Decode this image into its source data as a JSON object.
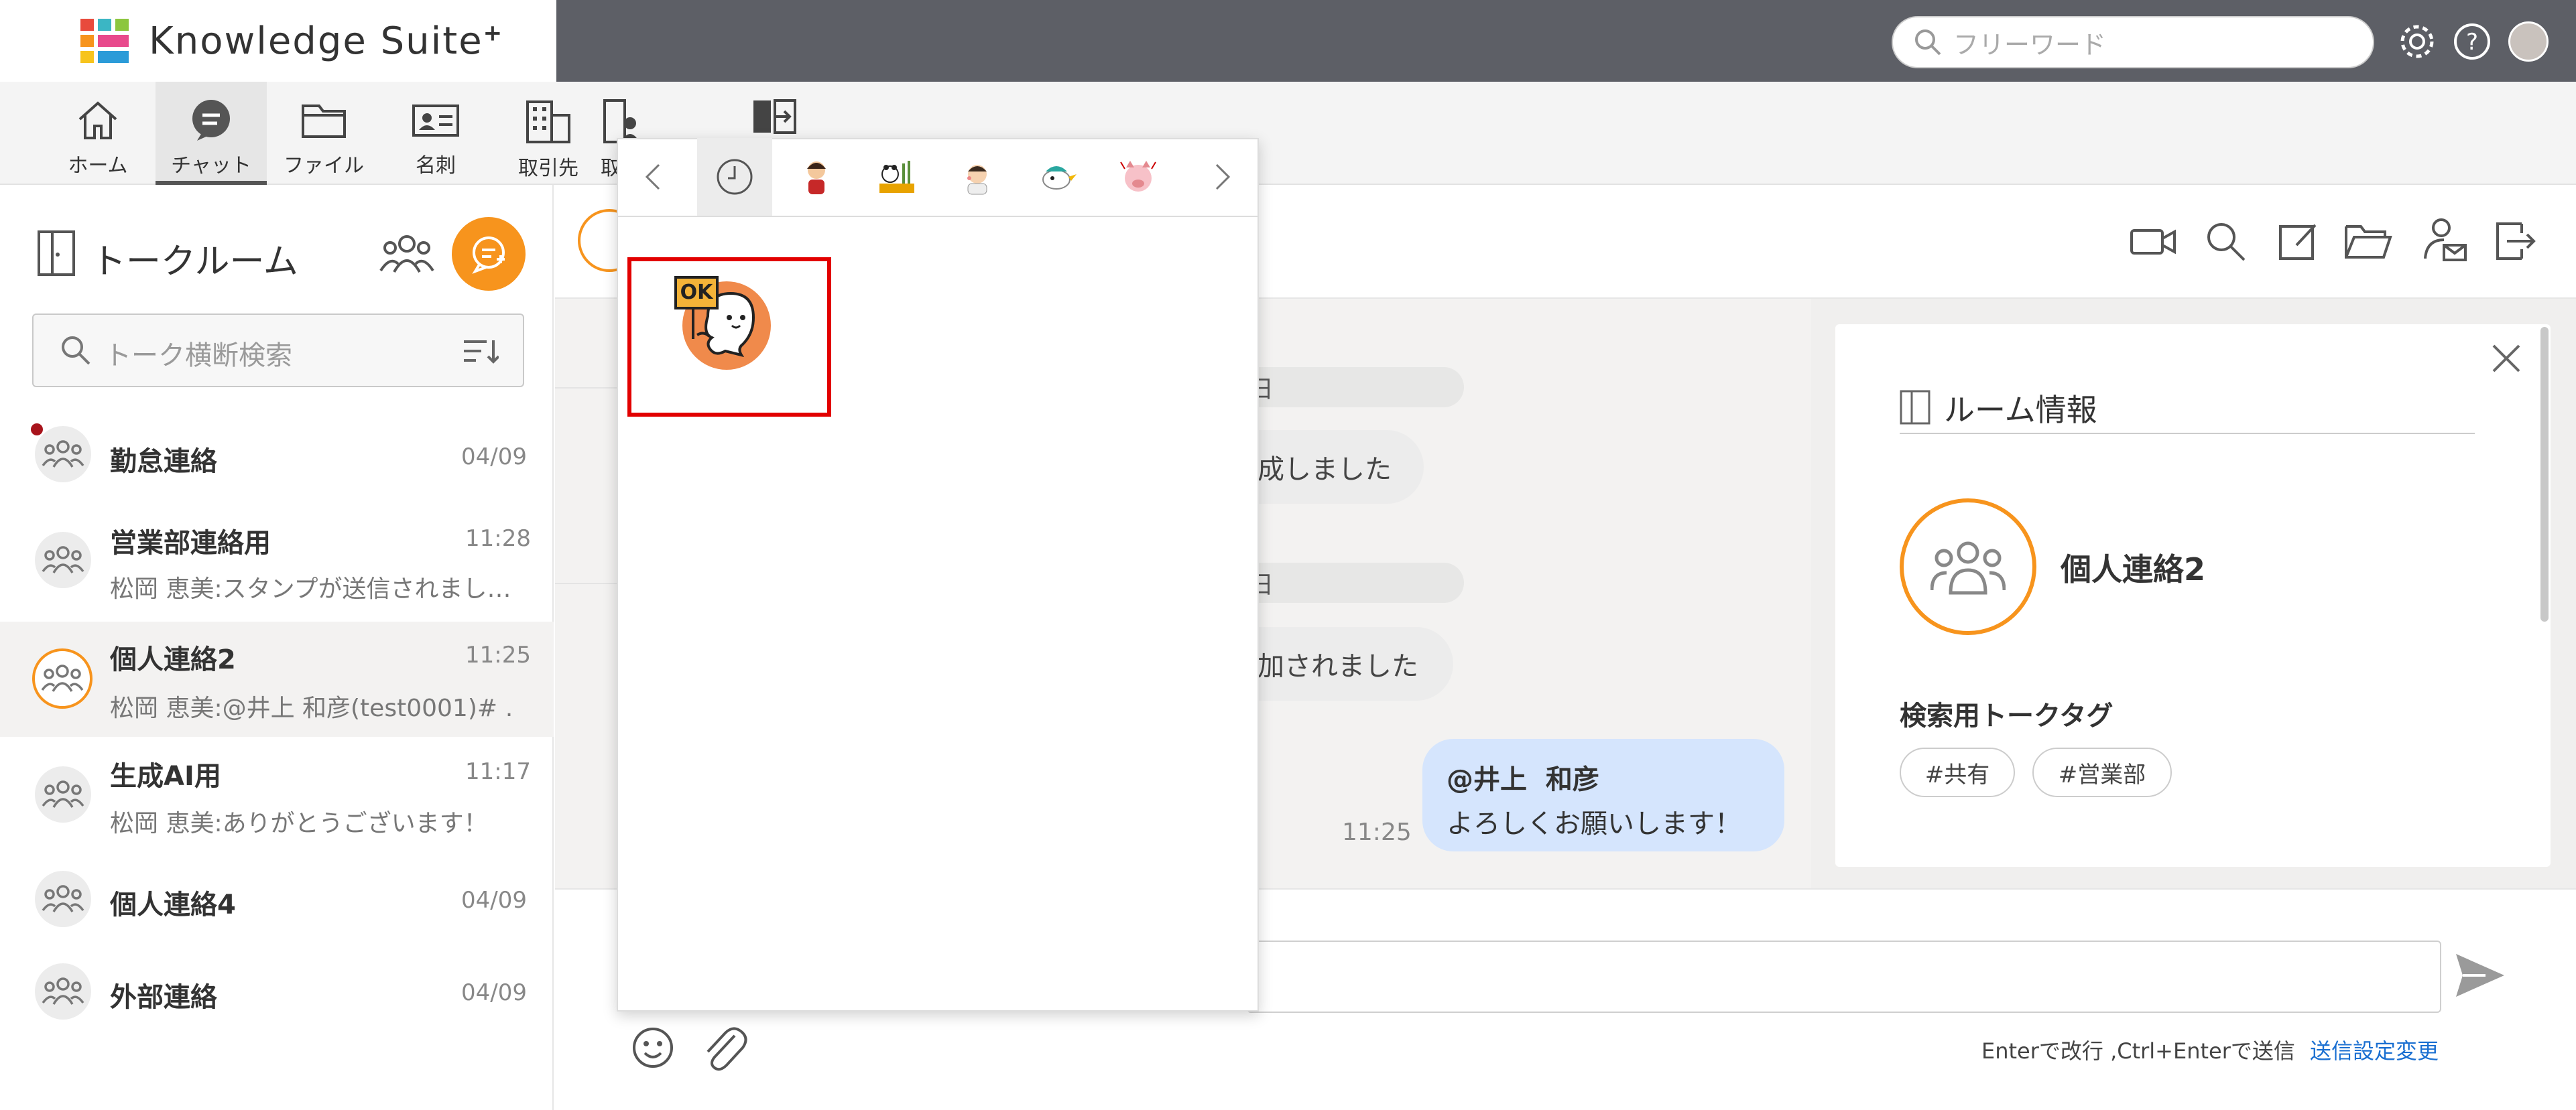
{
  "app": {
    "brand": "Knowledge Suite",
    "brand_sup": "+"
  },
  "header": {
    "search_placeholder": "フリーワード"
  },
  "nav": {
    "items": [
      {
        "label": "ホーム"
      },
      {
        "label": "チャット"
      },
      {
        "label": "ファイル"
      },
      {
        "label": "名刺"
      },
      {
        "label": "取引先"
      },
      {
        "label": "取"
      }
    ]
  },
  "sidebar": {
    "title": "トークルーム",
    "search_placeholder": "トーク横断検索",
    "rooms": [
      {
        "name": "勤怠連絡",
        "time": "04/09",
        "preview": "",
        "unread": true
      },
      {
        "name": "営業部連絡用",
        "time": "11:28",
        "preview": "松岡 恵美:スタンプが送信されまし…"
      },
      {
        "name": "個人連絡2",
        "time": "11:25",
        "preview": "松岡 恵美:@井上 和彦(test0001)# …",
        "active": true
      },
      {
        "name": "生成AI用",
        "time": "11:17",
        "preview": "松岡 恵美:ありがとうございます！"
      },
      {
        "name": "個人連絡4",
        "time": "04/09",
        "preview": ""
      },
      {
        "name": "外部連絡",
        "time": "04/09",
        "preview": ""
      }
    ]
  },
  "chat": {
    "date1": "日",
    "sys1": "成しました",
    "date2": "日",
    "sys2": "加されました",
    "my_message": {
      "mention": "@井上  和彦",
      "text": "よろしくお願いします！",
      "time": "11:25"
    },
    "input_hint": "Enterで改行 ,Ctrl+Enterで送信",
    "send_settings_link": "送信設定変更"
  },
  "room_info": {
    "title": "ルーム情報",
    "room_name": "個人連絡2",
    "tag_heading": "検索用トークタグ",
    "tags": [
      "#共有",
      "#営業部"
    ]
  },
  "stamp_picker": {
    "stamp_text": "OK"
  },
  "colors": {
    "header_bg": "#5d5f66",
    "accent_orange": "#f7941d",
    "selection_red": "#e20000",
    "my_bubble": "#d5e5fd",
    "link_blue": "#1a6fd1"
  }
}
